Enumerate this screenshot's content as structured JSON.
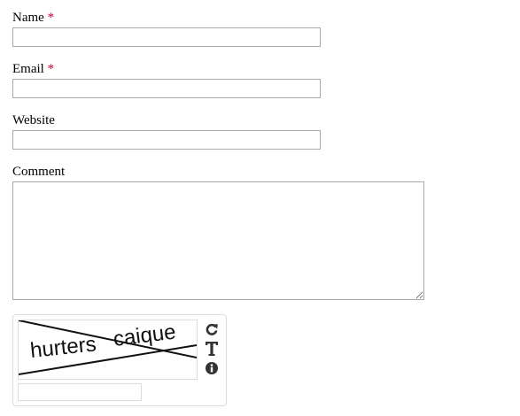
{
  "form": {
    "name": {
      "label": "Name",
      "required_mark": "*",
      "value": ""
    },
    "email": {
      "label": "Email",
      "required_mark": "*",
      "value": ""
    },
    "website": {
      "label": "Website",
      "value": ""
    },
    "comment": {
      "label": "Comment",
      "value": ""
    }
  },
  "captcha": {
    "words": [
      "hurters",
      "caique"
    ],
    "input_value": "",
    "tools": {
      "refresh_icon": "refresh-icon",
      "audio_text_icon": "text-mode-icon",
      "info_icon": "info-icon"
    }
  },
  "colors": {
    "required": "#cc0033",
    "border": "#a9a9a9",
    "captcha_border": "#dcdcdc",
    "icon": "#333333"
  }
}
